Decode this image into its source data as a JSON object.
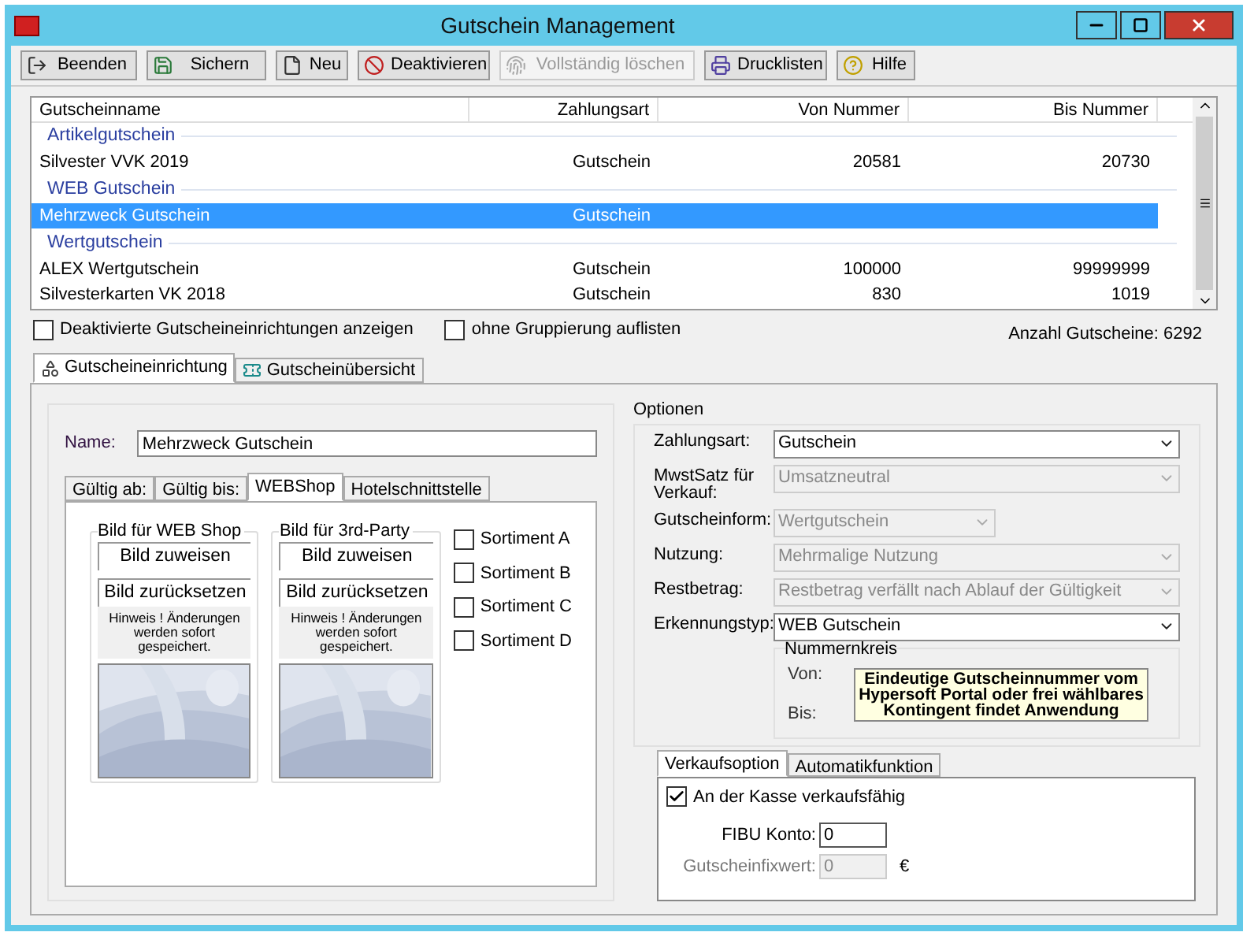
{
  "window": {
    "title": "Gutschein Management"
  },
  "toolbar": [
    {
      "label": "Beenden",
      "disabled": false
    },
    {
      "label": "Sichern",
      "disabled": false
    },
    {
      "label": "Neu",
      "disabled": false
    },
    {
      "label": "Deaktivieren",
      "disabled": false
    },
    {
      "label": "Vollständig löschen",
      "disabled": true
    },
    {
      "label": "Drucklisten",
      "disabled": false
    },
    {
      "label": "Hilfe",
      "disabled": false
    }
  ],
  "table": {
    "columns": [
      "Gutscheinname",
      "Zahlungsart",
      "Von Nummer",
      "Bis Nummer"
    ],
    "groups": [
      {
        "title": "Artikelgutschein",
        "rows": [
          {
            "cells": [
              "Silvester VVK 2019",
              "Gutschein",
              "20581",
              "20730"
            ],
            "selected": false
          }
        ]
      },
      {
        "title": "WEB Gutschein",
        "rows": [
          {
            "cells": [
              "Mehrzweck Gutschein",
              "Gutschein",
              "",
              ""
            ],
            "selected": true
          }
        ]
      },
      {
        "title": "Wertgutschein",
        "rows": [
          {
            "cells": [
              "ALEX Wertgutschein",
              "Gutschein",
              "100000",
              "99999999"
            ],
            "selected": false
          },
          {
            "cells": [
              "Silvesterkarten VK 2018",
              "Gutschein",
              "830",
              "1019"
            ],
            "selected": false
          }
        ]
      }
    ]
  },
  "filters": [
    {
      "label": "Deaktivierte Gutscheineinrichtungen anzeigen",
      "checked": false
    },
    {
      "label": "ohne Gruppierung auflisten",
      "checked": false
    }
  ],
  "count": "Anzahl Gutscheine: 6292",
  "tabs": [
    {
      "label": "Gutscheineinrichtung",
      "selected": true
    },
    {
      "label": "Gutscheinübersicht",
      "selected": false
    }
  ],
  "name": {
    "label": "Name:",
    "value": "Mehrzweck Gutschein"
  },
  "inner_tabs": [
    {
      "label": "Gültig ab:",
      "selected": false
    },
    {
      "label": "Gültig bis:",
      "selected": false
    },
    {
      "label": "WEBShop",
      "selected": true
    },
    {
      "label": "Hotelschnittstelle",
      "selected": false
    }
  ],
  "image_groups": [
    {
      "title": "Bild für WEB Shop",
      "assign": "Bild zuweisen",
      "reset": "Bild zurücksetzen",
      "note": "Hinweis ! Änderungen werden sofort gespeichert.",
      "kind": "picture"
    },
    {
      "title": "Bild für 3rd-Party",
      "assign": "Bild zuweisen",
      "reset": "Bild zurücksetzen",
      "note": "Hinweis ! Änderungen werden sofort gespeichert.",
      "kind": "picture"
    }
  ],
  "assortments": [
    {
      "label": "Sortiment A",
      "checked": false
    },
    {
      "label": "Sortiment B",
      "checked": false
    },
    {
      "label": "Sortiment C",
      "checked": false
    },
    {
      "label": "Sortiment D",
      "checked": false
    }
  ],
  "options": {
    "title": "Optionen",
    "fields": [
      {
        "label": "Zahlungsart:",
        "value": "Gutschein",
        "disabled": false,
        "wide": true
      },
      {
        "label": "MwstSatz für Verkauf:",
        "value": "Umsatzneutral",
        "disabled": true,
        "wide": true
      },
      {
        "label": "Gutscheinform:",
        "value": "Wertgutschein",
        "disabled": true,
        "wide": false
      },
      {
        "label": "Nutzung:",
        "value": "Mehrmalige Nutzung",
        "disabled": true,
        "wide": true
      },
      {
        "label": "Restbetrag:",
        "value": "Restbetrag verfällt nach Ablauf der Gültigkeit",
        "disabled": true,
        "wide": true
      },
      {
        "label": "Erkennungstyp:",
        "value": "WEB Gutschein",
        "disabled": false,
        "wide": true
      }
    ],
    "range": {
      "title": "Nummernkreis",
      "from": "Von:",
      "to": "Bis:",
      "note": "Eindeutige Gutscheinnummer vom Hypersoft Portal oder frei wählbares Kontingent findet Anwendung"
    }
  },
  "sale_tabs": [
    {
      "label": "Verkaufsoption",
      "selected": true
    },
    {
      "label": "Automatikfunktion",
      "selected": false
    }
  ],
  "sale": {
    "sellable": {
      "label": "An der Kasse verkaufsfähig",
      "checked": true
    },
    "account": {
      "label": "FIBU Konto:",
      "value": "0",
      "disabled": false
    },
    "fixed": {
      "label": "Gutscheinfixwert:",
      "value": "0",
      "disabled": true,
      "unit": "€"
    }
  }
}
